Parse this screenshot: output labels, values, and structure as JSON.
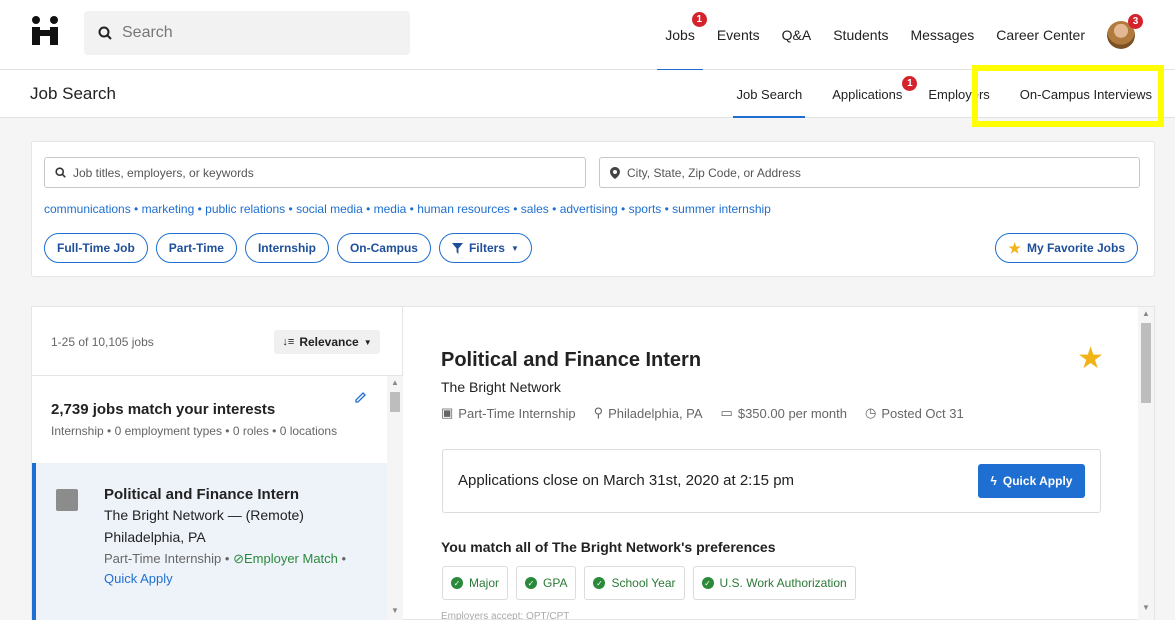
{
  "topnav": {
    "search_placeholder": "Search",
    "links": [
      {
        "label": "Jobs",
        "badge": "1",
        "active": true
      },
      {
        "label": "Events"
      },
      {
        "label": "Q&A"
      },
      {
        "label": "Students"
      },
      {
        "label": "Messages"
      },
      {
        "label": "Career Center"
      }
    ],
    "avatar_badge": "3"
  },
  "subnav": {
    "title": "Job Search",
    "tabs": [
      {
        "label": "Job Search",
        "active": true
      },
      {
        "label": "Applications",
        "badge": "1"
      },
      {
        "label": "Employers"
      },
      {
        "label": "On-Campus Interviews"
      }
    ]
  },
  "search": {
    "keywords_placeholder": "Job titles, employers, or keywords",
    "location_placeholder": "City, State, Zip Code, or Address",
    "suggestions": [
      "communications",
      "marketing",
      "public relations",
      "social media",
      "media",
      "human resources",
      "sales",
      "advertising",
      "sports",
      "summer internship"
    ],
    "filters": [
      "Full-Time Job",
      "Part-Time",
      "Internship",
      "On-Campus"
    ],
    "filters_button": "Filters",
    "favorites_button": "My Favorite Jobs"
  },
  "results": {
    "count": "1-25 of 10,105 jobs",
    "sort": "Relevance",
    "interests_title": "2,739 jobs match your interests",
    "interests_sub": "Internship • 0 employment types • 0 roles • 0 locations",
    "job": {
      "title": "Political and Finance Intern",
      "company_line": "The Bright Network — (Remote)",
      "location": "Philadelphia, PA",
      "type": "Part-Time Internship",
      "employer_match": "Employer Match",
      "quick_apply": "Quick Apply"
    }
  },
  "detail": {
    "title": "Political and Finance Intern",
    "company": "The Bright Network",
    "type": "Part-Time Internship",
    "location": "Philadelphia, PA",
    "pay": "$350.00 per month",
    "posted": "Posted Oct 31",
    "apply_close": "Applications close on March 31st, 2020 at 2:15 pm",
    "apply_button": "Quick Apply",
    "match_title": "You match all of The Bright Network's preferences",
    "match_tags": [
      "Major",
      "GPA",
      "School Year",
      "U.S. Work Authorization"
    ],
    "cut_text": "Employers accept: OPT/CPT"
  },
  "colors": {
    "accent": "#1e6fd1",
    "badge": "#d4232d",
    "highlight": "#ffff00",
    "success": "#2a8a3a"
  }
}
